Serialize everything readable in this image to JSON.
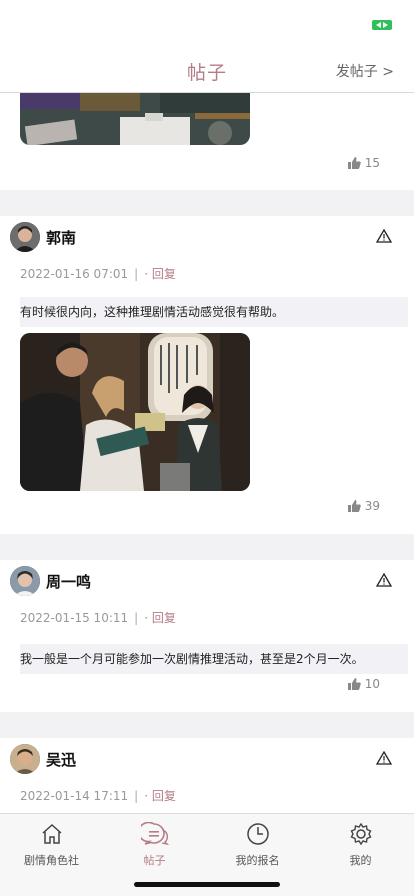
{
  "nav": {
    "title": "帖子",
    "action": "发帖子 >"
  },
  "posts": [
    {
      "likes": "15"
    },
    {
      "author": "郭南",
      "date": "2022-01-16 07:01",
      "sep": "|",
      "reply": "· 回复",
      "text": "有时候很内向，这种推理剧情活动感觉很有帮助。",
      "likes": "39"
    },
    {
      "author": "周一鸣",
      "date": "2022-01-15 10:11",
      "sep": "|",
      "reply": "· 回复",
      "text": "我一般是一个月可能参加一次剧情推理活动，甚至是2个月一次。",
      "likes": "10"
    },
    {
      "author": "吴迅",
      "date": "2022-01-14 17:11",
      "sep": "|",
      "reply": "· 回复"
    }
  ],
  "tabs": [
    {
      "label": "剧情角色社",
      "icon": "home-icon"
    },
    {
      "label": "帖子",
      "icon": "chat-icon"
    },
    {
      "label": "我的报名",
      "icon": "clock-icon"
    },
    {
      "label": "我的",
      "icon": "gear-icon"
    }
  ],
  "colors": {
    "accent": "#b57b86",
    "battery": "#2fbf5b"
  }
}
